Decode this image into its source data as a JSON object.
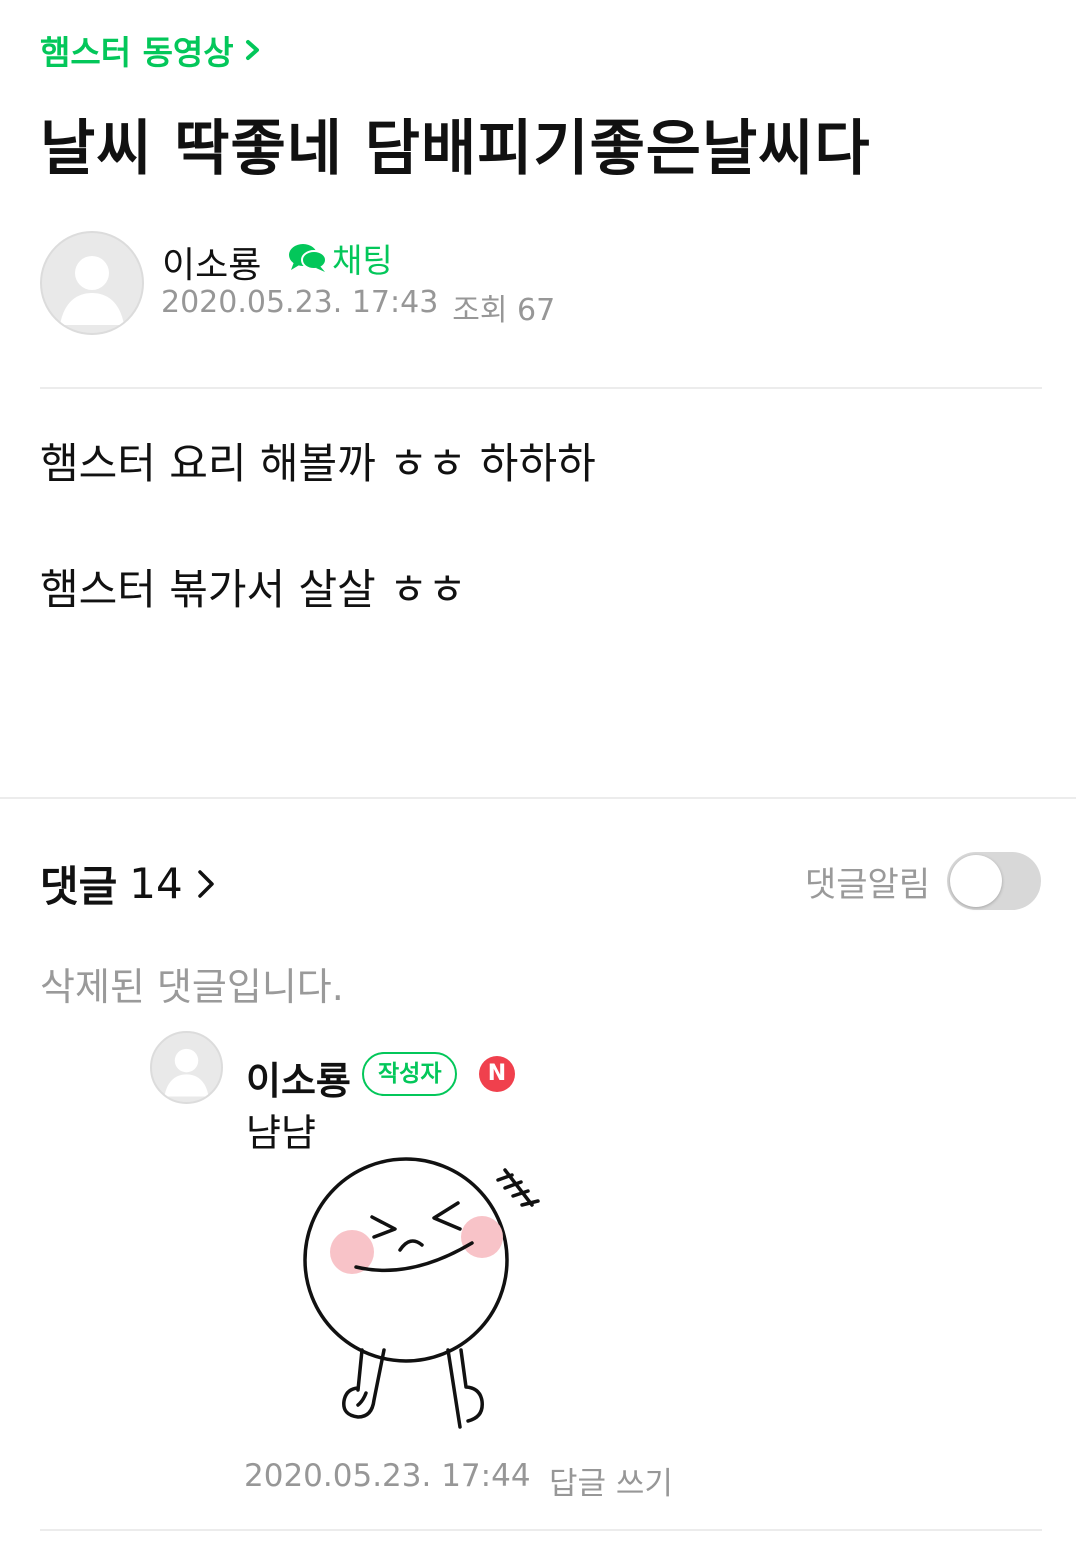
{
  "header": {
    "board_name": "햄스터 동영상",
    "title": "날씨 딱좋네 담배피기좋은날씨다"
  },
  "author": {
    "name": "이소룡",
    "chat_label": "채팅",
    "date": "2020.05.23. 17:43",
    "views": "조회 67"
  },
  "post": {
    "lines": [
      "햄스터 요리 해볼까 ㅎㅎ 하하하",
      "햄스터 볶가서 살살 ㅎㅎ"
    ]
  },
  "comments": {
    "label": "댓글",
    "count": "14",
    "notify_label": "댓글알림",
    "notify_on": false,
    "deleted_text": "삭제된 댓글입니다.",
    "reply": {
      "name": "이소룡",
      "author_badge": "작성자",
      "new_badge": "N",
      "text": "냠냠",
      "sticker": "laughing-face-sticker",
      "date": "2020.05.23. 17:44",
      "reply_link": "답글 쓰기"
    }
  },
  "colors": {
    "accent": "#03c75a",
    "new_badge": "#f0404d",
    "meta_text": "#979797"
  }
}
